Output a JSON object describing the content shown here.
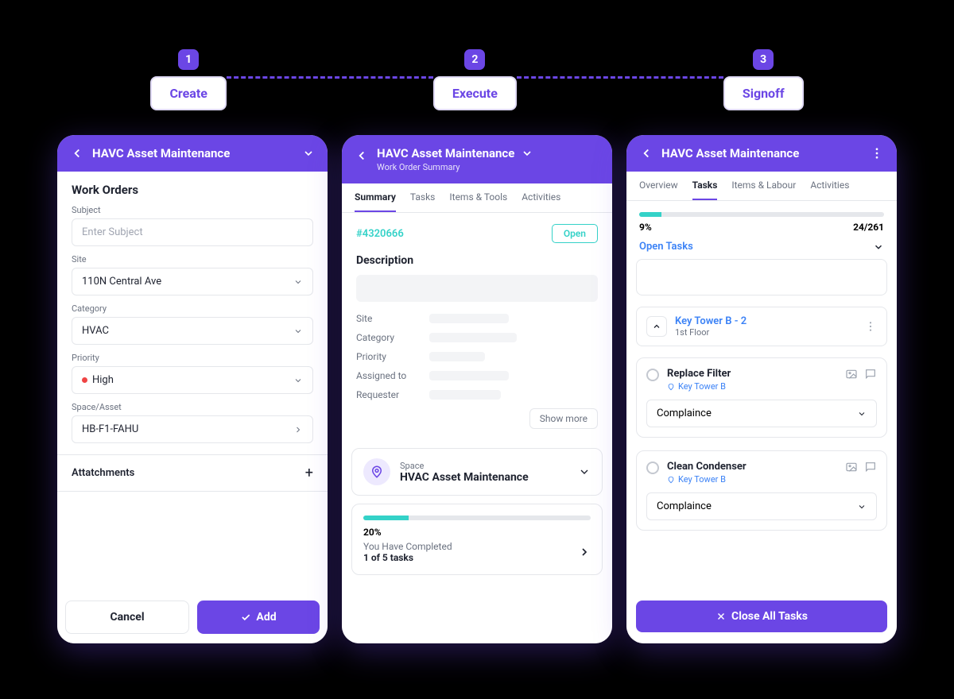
{
  "steps": [
    {
      "num": "1",
      "label": "Create"
    },
    {
      "num": "2",
      "label": "Execute"
    },
    {
      "num": "3",
      "label": "Signoff"
    }
  ],
  "create": {
    "header_title": "HAVC Asset Maintenance",
    "section": "Work Orders",
    "fields": {
      "subject_label": "Subject",
      "subject_placeholder": "Enter Subject",
      "site_label": "Site",
      "site_value": "110N Central Ave",
      "category_label": "Category",
      "category_value": "HVAC",
      "priority_label": "Priority",
      "priority_value": "High",
      "space_label": "Space/Asset",
      "space_value": "HB-F1-FAHU"
    },
    "attachments_label": "Attatchments",
    "cancel": "Cancel",
    "add": "Add"
  },
  "execute": {
    "header_title": "HAVC Asset Maintenance",
    "header_sub": "Work Order Summary",
    "tabs": [
      "Summary",
      "Tasks",
      "Items & Tools",
      "Activities"
    ],
    "active_tab": 0,
    "id": "#4320666",
    "status": "Open",
    "description_heading": "Description",
    "meta": [
      "Site",
      "Category",
      "Priority",
      "Assigned to",
      "Requester"
    ],
    "show_more": "Show more",
    "space_label": "Space",
    "space_title": "HVAC Asset Maintenance",
    "progress_pct": 20,
    "progress_text": "20%",
    "completed_line": "You Have Completed",
    "tasks_line": "1 of 5 tasks"
  },
  "signoff": {
    "header_title": "HAVC Asset Maintenance",
    "tabs": [
      "Overview",
      "Tasks",
      "Items & Labour",
      "Activities"
    ],
    "active_tab": 1,
    "progress_pct": 9,
    "progress_text": "9%",
    "counter": "24/261",
    "open_tasks": "Open Tasks",
    "group_title": "Key Tower B - 2",
    "group_sub": "1st Floor",
    "tasks": [
      {
        "title": "Replace Filter",
        "loc": "Key Tower B",
        "select": "Complaince"
      },
      {
        "title": "Clean Condenser",
        "loc": "Key Tower B",
        "select": "Complaince"
      }
    ],
    "close_all": "Close All Tasks"
  }
}
